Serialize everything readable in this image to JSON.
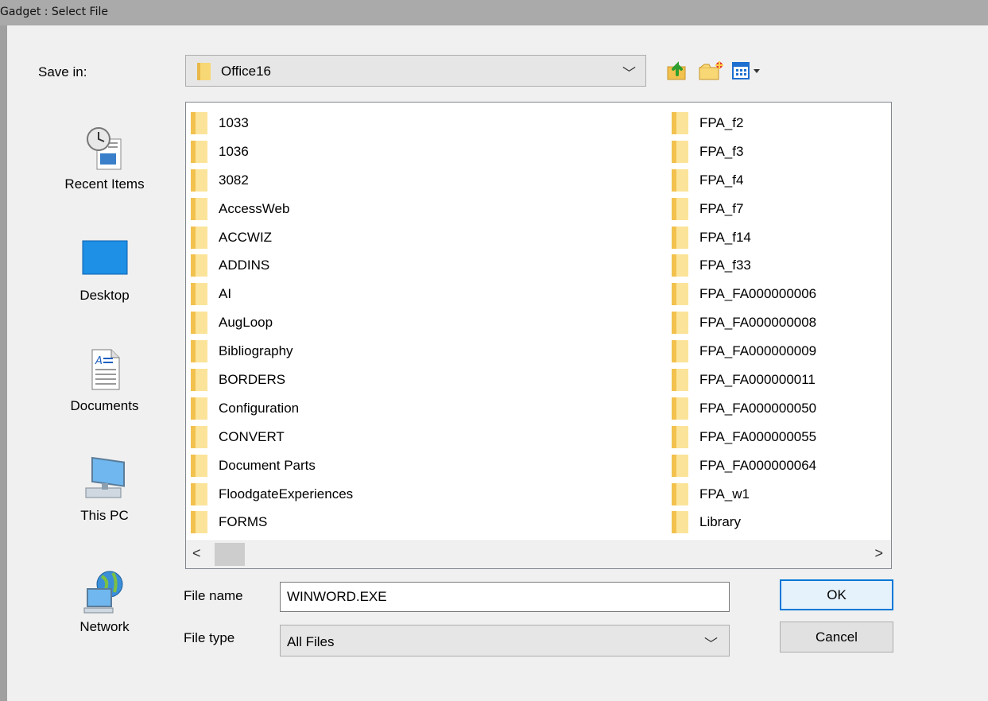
{
  "window": {
    "title": "Gadget : Select File"
  },
  "save_in": {
    "label": "Save in:",
    "value": "Office16"
  },
  "toolbar": {
    "up_icon": "up-folder-icon",
    "new_icon": "new-folder-icon",
    "view_icon": "view-menu-icon"
  },
  "places": [
    {
      "label": "Recent Items",
      "icon": "recent-items-icon"
    },
    {
      "label": "Desktop",
      "icon": "desktop-icon"
    },
    {
      "label": "Documents",
      "icon": "documents-icon"
    },
    {
      "label": "This PC",
      "icon": "this-pc-icon"
    },
    {
      "label": "Network",
      "icon": "network-icon"
    }
  ],
  "files_col1": [
    "1033",
    "1036",
    "3082",
    "AccessWeb",
    "ACCWIZ",
    "ADDINS",
    "AI",
    "AugLoop",
    "Bibliography",
    "BORDERS",
    "Configuration",
    "CONVERT",
    "Document Parts",
    "FloodgateExperiences",
    "FORMS"
  ],
  "files_col2": [
    "FPA_f2",
    "FPA_f3",
    "FPA_f4",
    "FPA_f7",
    "FPA_f14",
    "FPA_f33",
    "FPA_FA000000006",
    "FPA_FA000000008",
    "FPA_FA000000009",
    "FPA_FA000000011",
    "FPA_FA000000050",
    "FPA_FA000000055",
    "FPA_FA000000064",
    "FPA_w1",
    "Library"
  ],
  "file_name": {
    "label": "File name",
    "value": "WINWORD.EXE"
  },
  "file_type": {
    "label": "File type",
    "value": "All Files"
  },
  "buttons": {
    "ok": "OK",
    "cancel": "Cancel"
  },
  "colors": {
    "accent": "#0078d7",
    "folder": "#f8d775"
  }
}
